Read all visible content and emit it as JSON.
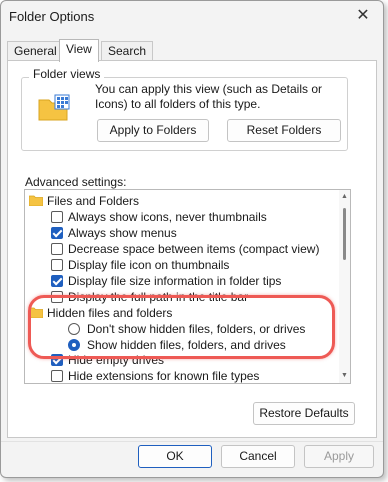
{
  "window": {
    "title": "Folder Options",
    "close_glyph": "✕"
  },
  "tabs": [
    {
      "label": "General"
    },
    {
      "label": "View"
    },
    {
      "label": "Search"
    }
  ],
  "folder_views": {
    "label": "Folder views",
    "description": "You can apply this view (such as Details or Icons) to all folders of this type.",
    "apply_button": "Apply to Folders",
    "reset_button": "Reset Folders"
  },
  "advanced": {
    "label": "Advanced settings:",
    "items": [
      {
        "type": "folder",
        "label": "Files and Folders"
      },
      {
        "type": "checkbox",
        "checked": false,
        "label": "Always show icons, never thumbnails"
      },
      {
        "type": "checkbox",
        "checked": true,
        "label": "Always show menus"
      },
      {
        "type": "checkbox",
        "checked": false,
        "label": "Decrease space between items (compact view)"
      },
      {
        "type": "checkbox",
        "checked": false,
        "label": "Display file icon on thumbnails"
      },
      {
        "type": "checkbox",
        "checked": true,
        "label": "Display file size information in folder tips"
      },
      {
        "type": "checkbox",
        "checked": false,
        "label": "Display the full path in the title bar"
      },
      {
        "type": "folder",
        "label": "Hidden files and folders"
      },
      {
        "type": "radio",
        "checked": false,
        "label": "Don't show hidden files, folders, or drives"
      },
      {
        "type": "radio",
        "checked": true,
        "label": "Show hidden files, folders, and drives"
      },
      {
        "type": "checkbox",
        "checked": true,
        "label": "Hide empty drives"
      },
      {
        "type": "checkbox",
        "checked": false,
        "label": "Hide extensions for known file types"
      }
    ]
  },
  "restore_button": "Restore Defaults",
  "footer": {
    "ok": "OK",
    "cancel": "Cancel",
    "apply": "Apply"
  },
  "colors": {
    "accent": "#1f5fbf",
    "highlight": "#ee5a55",
    "folder": "#f5c342"
  }
}
